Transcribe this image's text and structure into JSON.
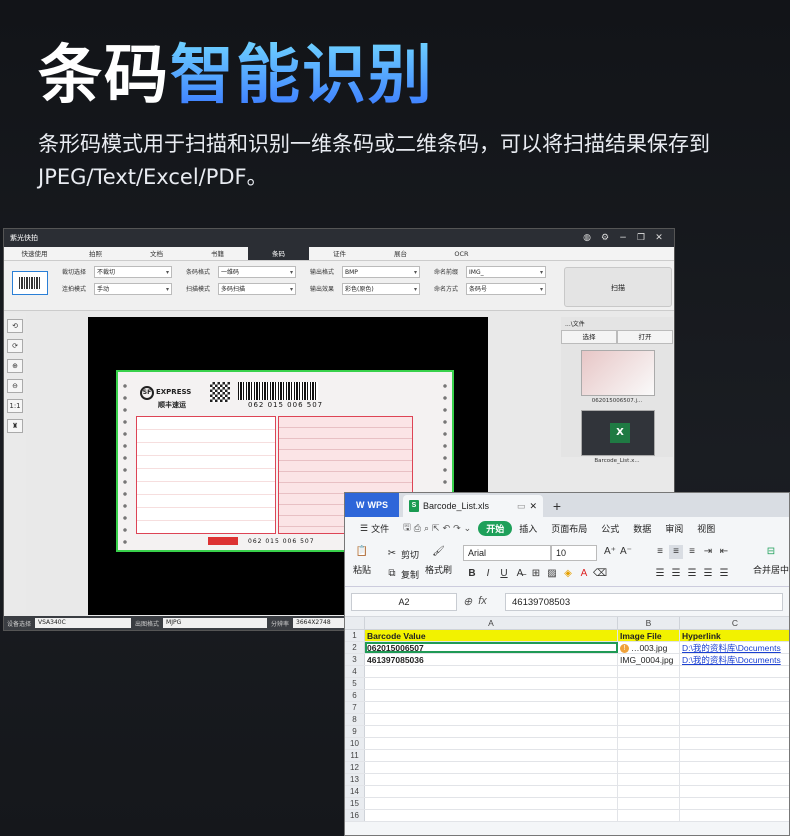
{
  "hero": {
    "title_part1": "条码",
    "title_part2": "智能识别",
    "subtitle": "条形码模式用于扫描和识别一维条码或二维条码，可以将扫描结果保存到JPEG/Text/Excel/PDF。"
  },
  "colors": {
    "accent_blue": "#3a78ff",
    "wps_blue": "#2e66d9",
    "wps_green": "#1ea05a",
    "header_yellow": "#f2f200",
    "scan_border_green": "#38d14b"
  },
  "scanner_app": {
    "title": "紫光快拍",
    "window_controls": [
      "globe-icon",
      "gear-icon",
      "minimize-icon",
      "restore-icon",
      "close-icon"
    ],
    "tabs": [
      "快速使用",
      "拍照",
      "文档",
      "书籍",
      "条码",
      "证件",
      "展台",
      "OCR"
    ],
    "active_tab": "条码",
    "toolbar": {
      "crop_label": "裁切选择",
      "crop_value": "不裁切",
      "shoot_mode_label": "连拍模式",
      "shoot_mode_value": "手动",
      "barcode_format_label": "条码格式",
      "barcode_format_value": "一维码",
      "scan_mode_label": "扫描模式",
      "scan_mode_value": "多码扫描",
      "out_format_label": "输出格式",
      "out_format_value": "BMP",
      "out_effect_label": "输出效果",
      "out_effect_value": "彩色(原色)",
      "name_prefix_label": "命名前缀",
      "name_prefix_value": "IMG_",
      "name_mode_label": "命名方式",
      "name_mode_value": "条码号",
      "scan_button": "扫描"
    },
    "side_tools": [
      "rotate-left-icon",
      "rotate-right-icon",
      "zoom-in-icon",
      "zoom-out-icon",
      "actual-size-icon",
      "stamp-icon"
    ],
    "side_tool_glyphs": [
      "⟲",
      "⟳",
      "⊕",
      "⊖",
      "1:1",
      "♜"
    ],
    "document": {
      "brand": "EXPRESS",
      "brand_sub": "顺丰速运",
      "barcode_number": "062 015 006 507",
      "footer_number": "062 015 006 507"
    },
    "right_panel": {
      "header": "...\\文件",
      "select_button": "选择",
      "open_button": "打开",
      "thumb1_caption": "062015006507.j...",
      "thumb2_caption": "Barcode_List.x..."
    },
    "status": {
      "device_label": "设备选择",
      "device_value": "VSA340C",
      "format_label": "出图格式",
      "format_value": "MJPG",
      "resolution_label": "分辨率",
      "resolution_value": "3664X2748"
    }
  },
  "wps": {
    "app_name": "WPS",
    "file_tab": "Barcode_List.xls",
    "new_tab": "+",
    "menu": [
      "文件",
      "开始",
      "插入",
      "页面布局",
      "公式",
      "数据",
      "审阅",
      "视图"
    ],
    "active_menu": "开始",
    "ribbon": {
      "paste": "粘贴",
      "cut": "剪切",
      "copy": "复制",
      "format_painter": "格式刷",
      "font_name": "Arial",
      "font_size": "10",
      "merge_center": "合并居中"
    },
    "name_box": "A2",
    "formula_value": "46139708503",
    "columns": [
      "A",
      "B",
      "C"
    ],
    "header_row": [
      "Barcode Value",
      "Image File",
      "Hyperlink"
    ],
    "rows": [
      [
        "062015006507",
        "…003.jpg",
        "D:\\我的资料库\\Documents"
      ],
      [
        "461397085036",
        "IMG_0004.jpg",
        "D:\\我的资料库\\Documents"
      ]
    ],
    "row_numbers": [
      "1",
      "2",
      "3",
      "4",
      "5",
      "6",
      "7",
      "8",
      "9",
      "10",
      "11",
      "12",
      "13",
      "14",
      "15",
      "16"
    ]
  }
}
